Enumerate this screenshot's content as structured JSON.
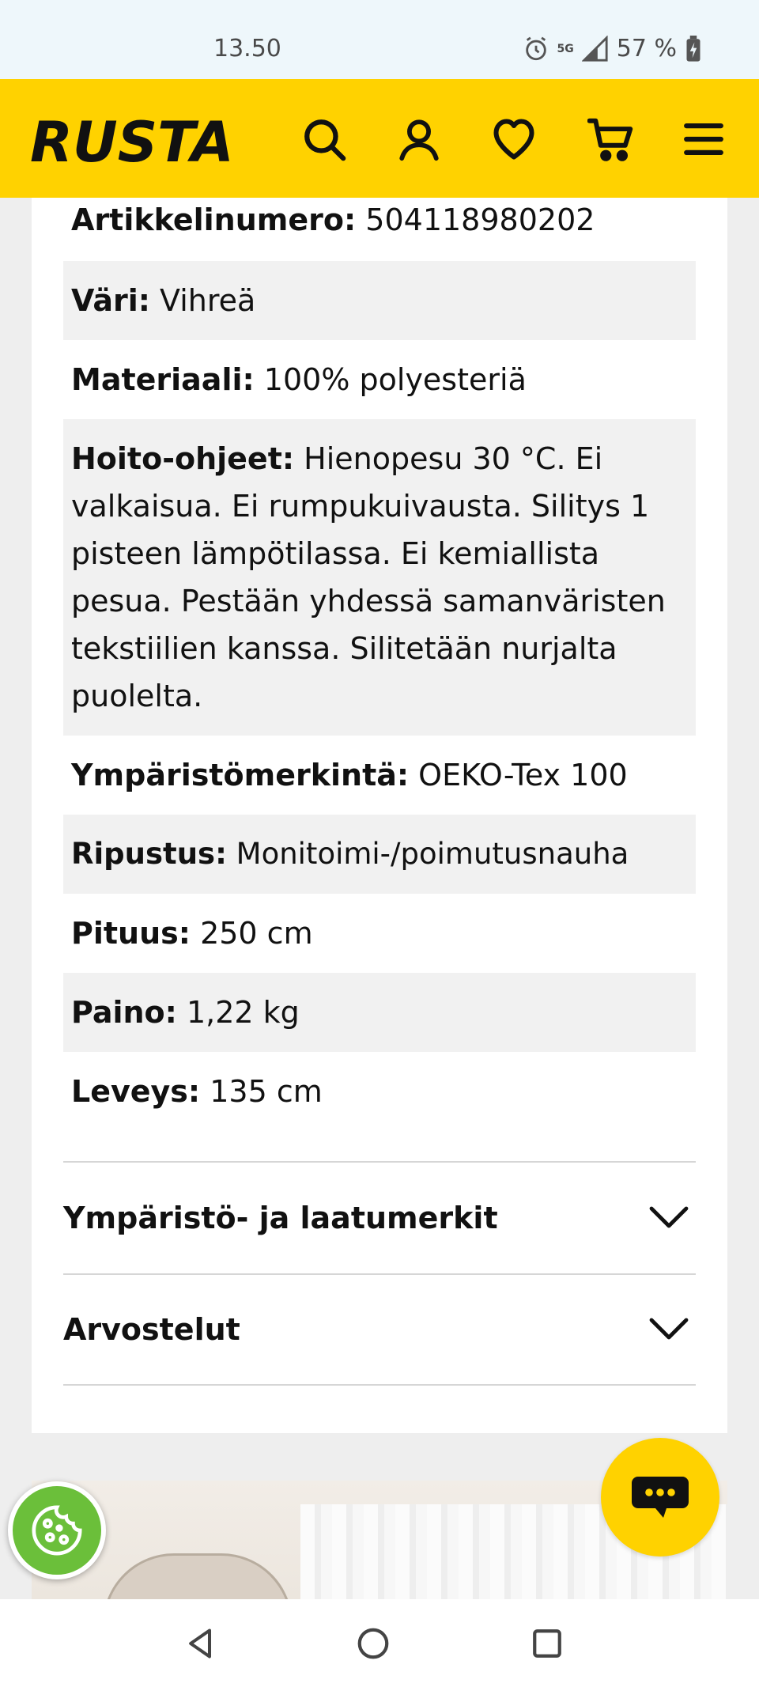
{
  "status_bar": {
    "time": "13.50",
    "network": "5G",
    "battery": "57 %"
  },
  "header": {
    "logo_text": "RUSTA",
    "icons": [
      "search-icon",
      "account-icon",
      "heart-icon",
      "cart-icon",
      "menu-icon"
    ],
    "bg_color": "#ffd200"
  },
  "specs": [
    {
      "label": "Artikkelinumero:",
      "value": "504118980202"
    },
    {
      "label": "Väri:",
      "value": "Vihreä"
    },
    {
      "label": "Materiaali:",
      "value": "100% polyesteriä"
    },
    {
      "label": "Hoito-ohjeet:",
      "value": "Hienopesu 30 °C. Ei valkaisua. Ei rumpukuivausta. Silitys 1 pisteen lämpötilassa. Ei kemiallista pesua. Pestään yhdessä samanväristen tekstiilien kanssa. Silitetään nurjalta puolelta."
    },
    {
      "label": "Ympäristömerkintä:",
      "value": "OEKO-Tex 100"
    },
    {
      "label": "Ripustus:",
      "value": "Monitoimi-/poimutusnauha"
    },
    {
      "label": "Pituus:",
      "value": "250 cm"
    },
    {
      "label": "Paino:",
      "value": "1,22 kg"
    },
    {
      "label": "Leveys:",
      "value": "135 cm"
    }
  ],
  "accordions": [
    {
      "title": "Ympäristö- ja laatumerkit"
    },
    {
      "title": "Arvostelut"
    }
  ],
  "floating": {
    "chat_icon": "chat-icon",
    "cookie_icon": "cookie-icon"
  },
  "nav": [
    "back-icon",
    "home-icon",
    "recents-icon"
  ]
}
